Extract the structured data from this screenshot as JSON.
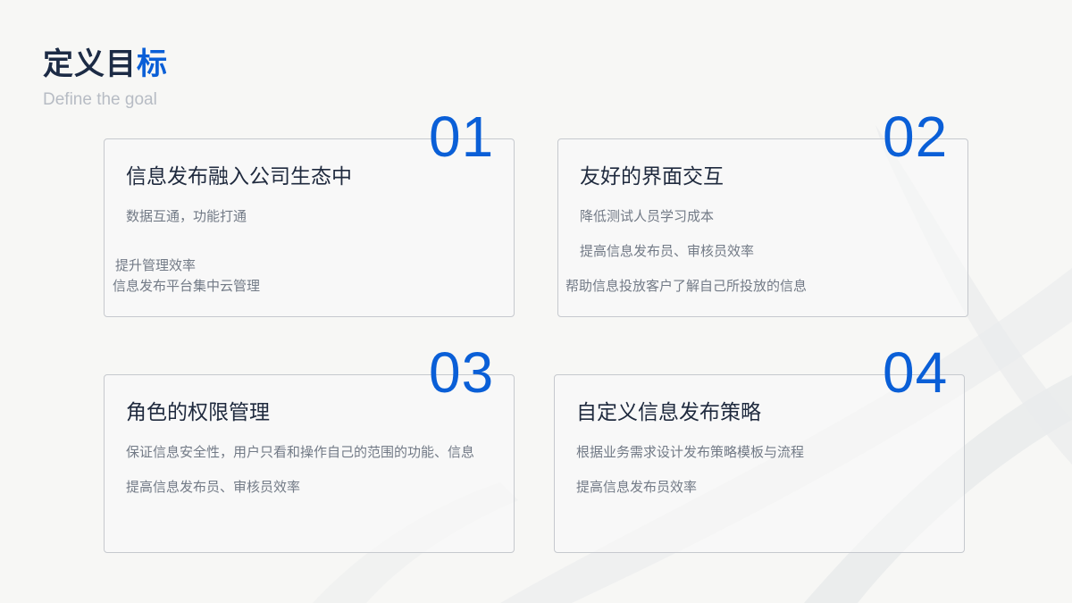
{
  "header": {
    "title_main": "定义目",
    "title_accent": "标",
    "subtitle": "Define the goal"
  },
  "colors": {
    "accent": "#0a5fd7",
    "title": "#1c2b45",
    "body_text": "#727a86",
    "background": "#f7f7f5"
  },
  "cards": [
    {
      "number": "01",
      "title": "信息发布融入公司生态中",
      "lines": [
        "数据互通，功能打通",
        "提升管理效率",
        "信息发布平台集中云管理"
      ]
    },
    {
      "number": "02",
      "title": "友好的界面交互",
      "lines": [
        "降低测试人员学习成本",
        "提高信息发布员、审核员效率",
        "帮助信息投放客户了解自己所投放的信息"
      ]
    },
    {
      "number": "03",
      "title": "角色的权限管理",
      "lines": [
        "保证信息安全性，用户只看和操作自己的范围的功能、信息",
        "提高信息发布员、审核员效率"
      ]
    },
    {
      "number": "04",
      "title": "自定义信息发布策略",
      "lines": [
        "根据业务需求设计发布策略模板与流程",
        "提高信息发布员效率"
      ]
    }
  ]
}
